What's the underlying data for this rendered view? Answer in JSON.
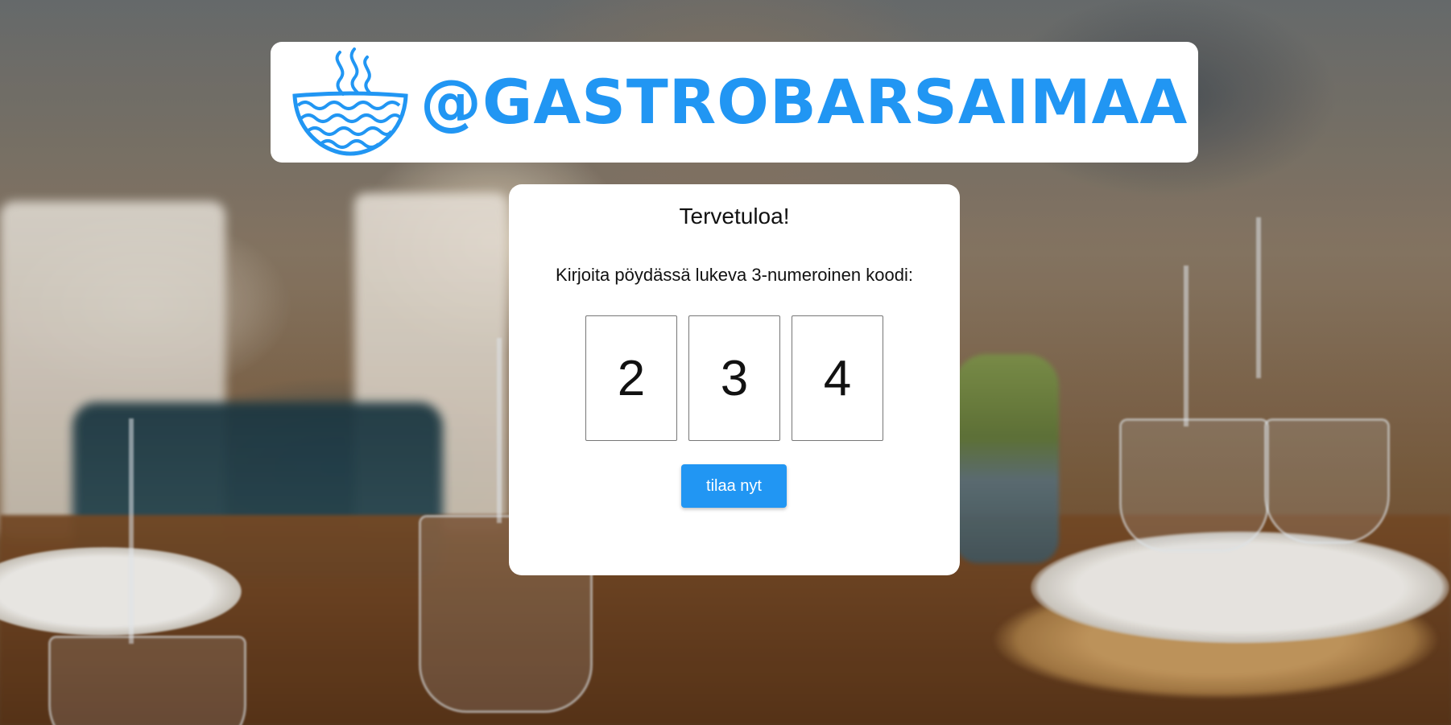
{
  "header": {
    "brand_text": "@GASTROBARSAIMAA",
    "logo_icon": "steaming-bowl-icon",
    "brand_color": "#2196f3"
  },
  "card": {
    "title": "Tervetuloa!",
    "instruction": "Kirjoita pöydässä lukeva 3-numeroinen koodi:",
    "code_digits": [
      "2",
      "3",
      "4"
    ],
    "submit_label": "tilaa nyt",
    "button_color": "#2196f3"
  },
  "background": {
    "description_icon": "restaurant-background-photo"
  }
}
